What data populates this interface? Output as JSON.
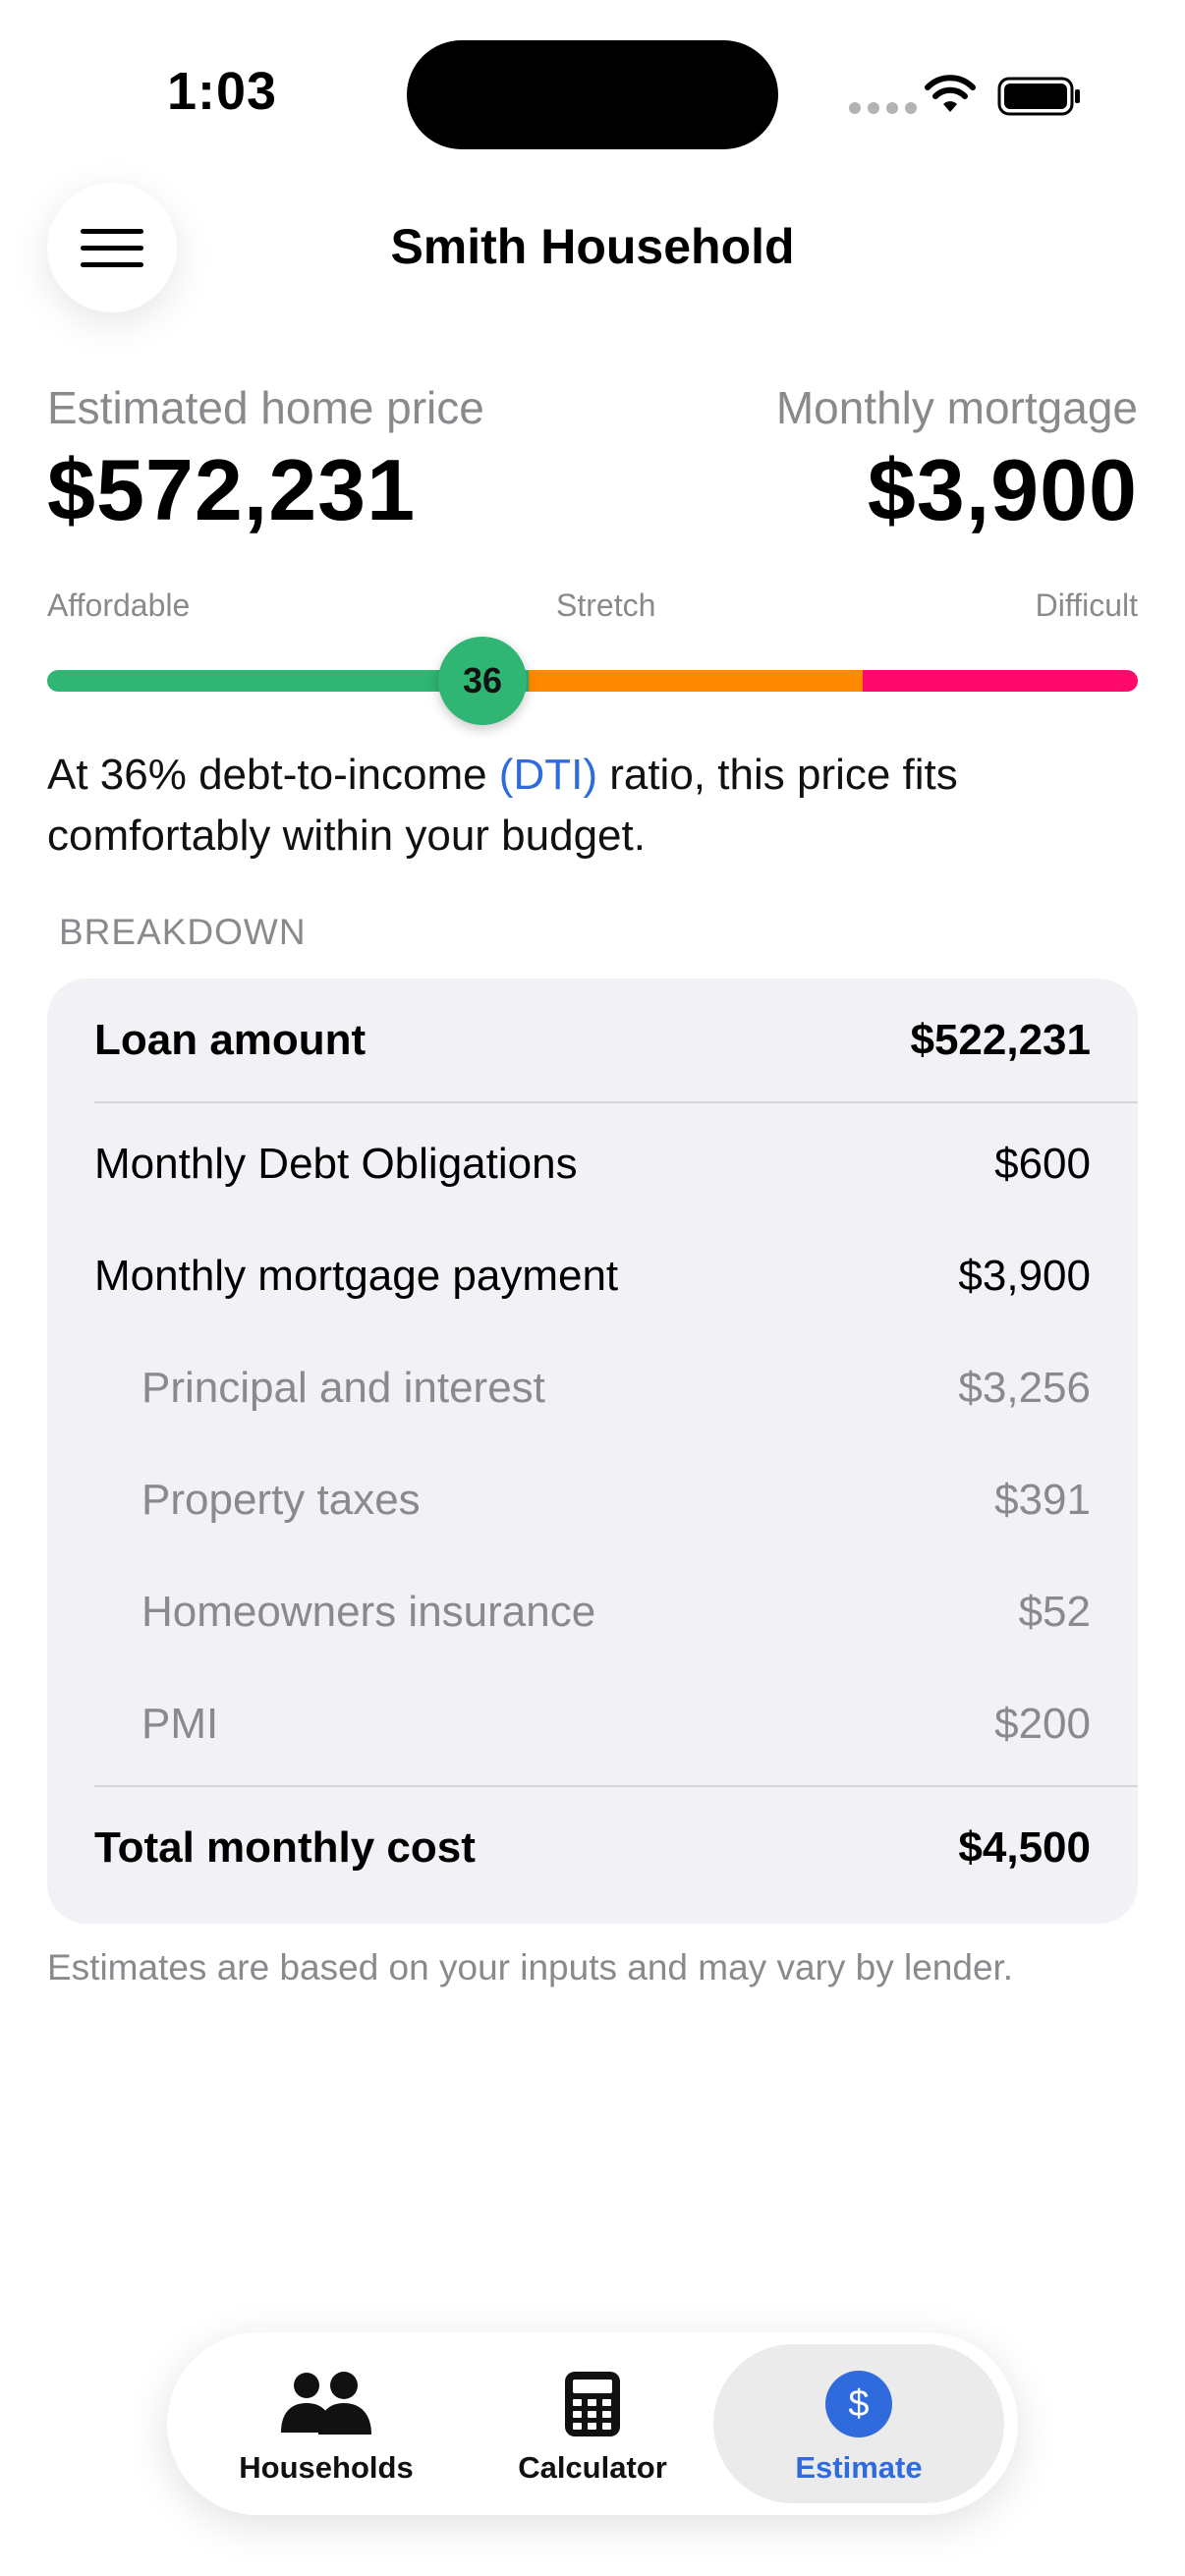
{
  "status_bar": {
    "time": "1:03"
  },
  "header": {
    "title": "Smith Household",
    "menu_icon": "hamburger-menu-icon"
  },
  "summary": {
    "home_price_label": "Estimated home price",
    "home_price_value": "$572,231",
    "mortgage_label": "Monthly mortgage",
    "mortgage_value": "$3,900"
  },
  "affordability_scale": {
    "labels": [
      "Affordable",
      "Stretch",
      "Difficult"
    ],
    "dti_value": "36",
    "colors": {
      "affordable": "#2fb574",
      "stretch": "#ff8a00",
      "difficult": "#ff0a6c"
    }
  },
  "dti_message": {
    "prefix": "At 36% debt-to-income ",
    "link": "(DTI)",
    "suffix": " ratio, this price fits comfortably within your budget."
  },
  "breakdown": {
    "header": "BREAKDOWN",
    "loan_amount": {
      "label": "Loan amount",
      "value": "$522,231"
    },
    "items": [
      {
        "label": "Monthly Debt Obligations",
        "value": "$600"
      },
      {
        "label": "Monthly mortgage payment",
        "value": "$3,900"
      }
    ],
    "sub_items": [
      {
        "label": "Principal and interest",
        "value": "$3,256"
      },
      {
        "label": "Property taxes",
        "value": "$391"
      },
      {
        "label": "Homeowners insurance",
        "value": "$52"
      },
      {
        "label": "PMI",
        "value": "$200"
      }
    ],
    "total": {
      "label": "Total monthly cost",
      "value": "$4,500"
    }
  },
  "footnote": "Estimates are based on your inputs and may vary by lender.",
  "tabs": [
    {
      "label": "Households",
      "icon": "people-icon"
    },
    {
      "label": "Calculator",
      "icon": "calculator-icon"
    },
    {
      "label": "Estimate",
      "icon": "dollar-icon",
      "active": true
    }
  ],
  "accent_color": "#2f6bdc"
}
